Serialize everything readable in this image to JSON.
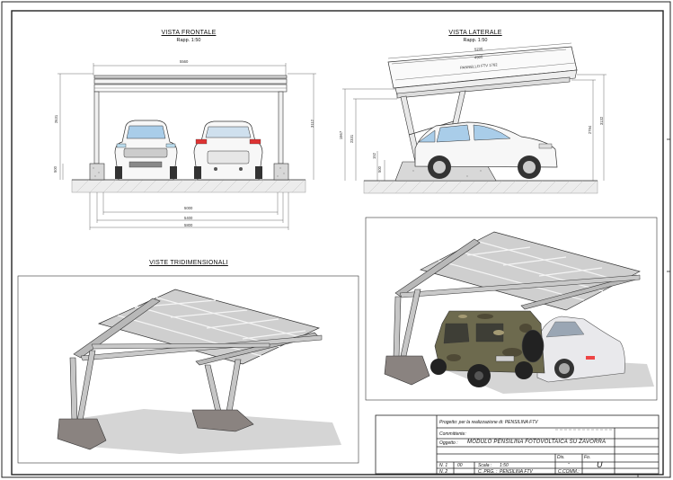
{
  "views": {
    "front": {
      "title": "VISTA FRONTALE",
      "scale": "Rapp. 1:50"
    },
    "side": {
      "title": "VISTA LATERALE",
      "scale": "Rapp. 1:50"
    },
    "three_d": {
      "title": "VISTE TRIDIMENSIONALI"
    }
  },
  "dimensions": {
    "front_top": "5560",
    "front_width_inner": "5000",
    "front_width_mid": "5400",
    "front_width_outer": "5800",
    "front_left_height": "2631",
    "front_right_height": "3112",
    "front_base": "500",
    "side_top": "5236",
    "side_second": "4900",
    "side_panel_label": "PANNELLO FTV 1762",
    "side_left_height": "1967",
    "side_left_inner": "2331",
    "side_right_inner": "2794",
    "side_right_height": "3132",
    "side_small_1": "152",
    "side_small_2": "500"
  },
  "title_block": {
    "project": "Progetto: per la realizzazione di: PENSILINA FTV",
    "client": "Committente:",
    "object_label": "Oggetto :",
    "object_value": "MODULO PENSILINA FOTOVOLTAICA SU ZAVORRA",
    "drawing_no_label": "N. 1",
    "drawing_no_value": "00",
    "drawing_no2_label": "N. 2",
    "scale_label": "Scala :",
    "scale_value": "1:50",
    "code_label": "C. PRG. :",
    "code_value": "PENSILINA FTV",
    "comm_label": "C.COMM.:",
    "dis_label": "Dis.",
    "dis_value": "-",
    "fo_label": "Fo.",
    "fo_value": "U"
  }
}
